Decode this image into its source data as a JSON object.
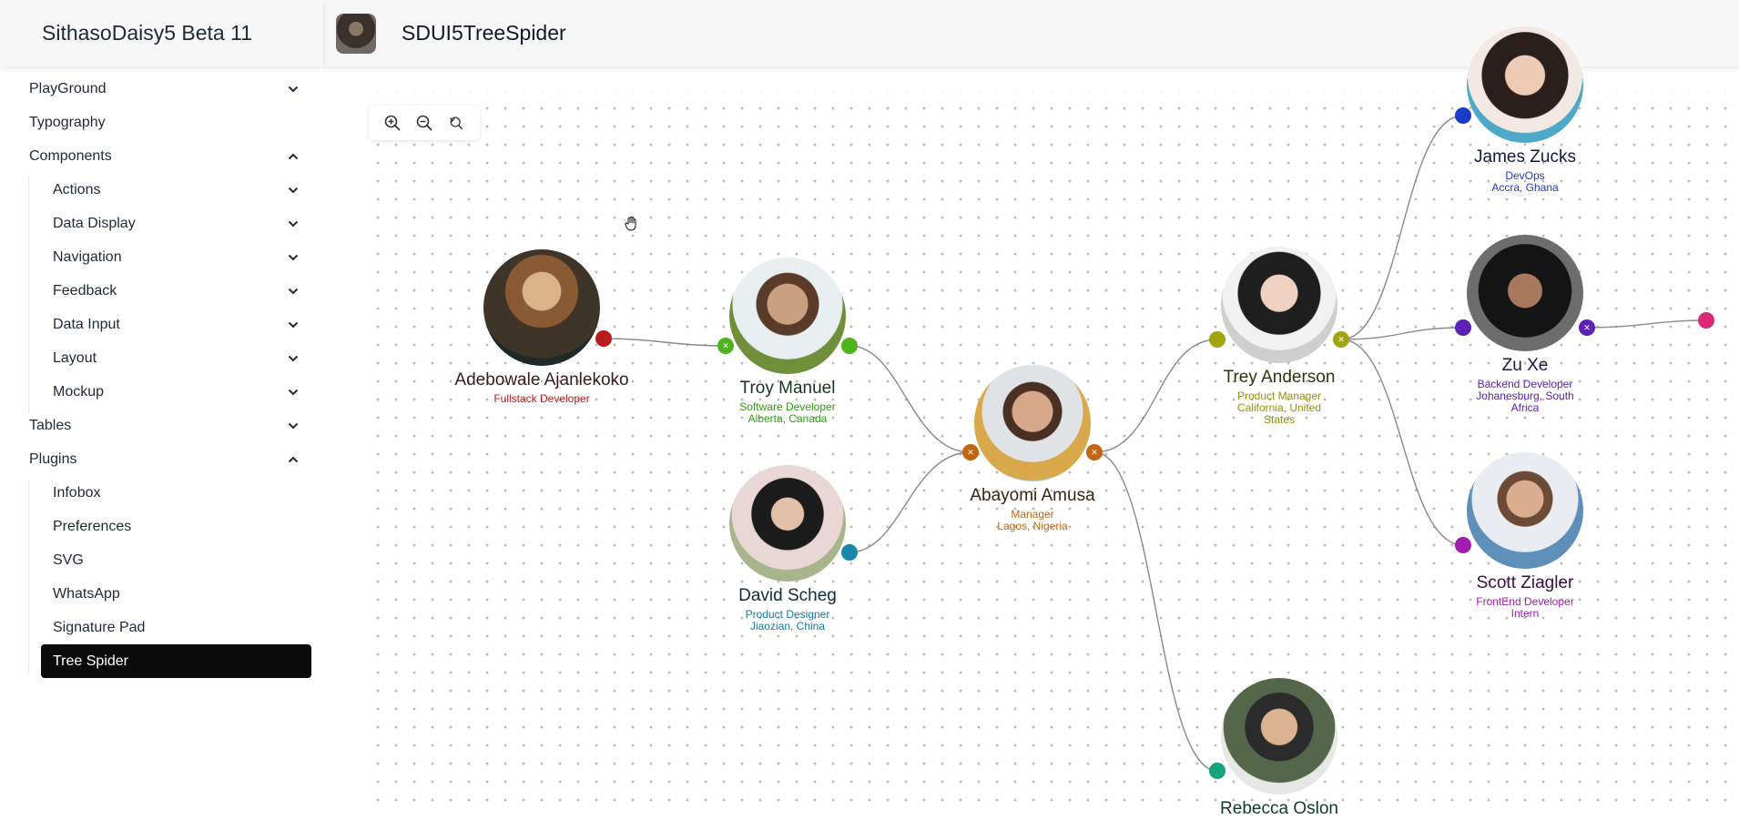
{
  "app": {
    "title": "SithasoDaisy5 Beta 11",
    "page_title": "SDUI5TreeSpider"
  },
  "sidebar": {
    "items": [
      {
        "label": "PlayGround",
        "chevron": "down",
        "level": 0
      },
      {
        "label": "Typography",
        "chevron": "",
        "level": 0
      },
      {
        "label": "Components",
        "chevron": "up",
        "level": 0
      },
      {
        "label": "Actions",
        "chevron": "down",
        "level": 1
      },
      {
        "label": "Data Display",
        "chevron": "down",
        "level": 1
      },
      {
        "label": "Navigation",
        "chevron": "down",
        "level": 1
      },
      {
        "label": "Feedback",
        "chevron": "down",
        "level": 1
      },
      {
        "label": "Data Input",
        "chevron": "down",
        "level": 1
      },
      {
        "label": "Layout",
        "chevron": "down",
        "level": 1
      },
      {
        "label": "Mockup",
        "chevron": "down",
        "level": 1
      },
      {
        "label": "Tables",
        "chevron": "down",
        "level": 0
      },
      {
        "label": "Plugins",
        "chevron": "up",
        "level": 0
      },
      {
        "label": "Infobox",
        "chevron": "",
        "level": 1
      },
      {
        "label": "Preferences",
        "chevron": "",
        "level": 1
      },
      {
        "label": "SVG",
        "chevron": "",
        "level": 1
      },
      {
        "label": "WhatsApp",
        "chevron": "",
        "level": 1
      },
      {
        "label": "Signature Pad",
        "chevron": "",
        "level": 1
      },
      {
        "label": "Tree Spider",
        "chevron": "",
        "level": 1,
        "active": true
      }
    ]
  },
  "toolbar": {
    "zoom_in": "zoom-in-icon",
    "zoom_out": "zoom-out-icon",
    "reset": "zoom-reset-icon"
  },
  "tree": {
    "nodes": {
      "adebowale": {
        "name": "Adebowale Ajanlekoko",
        "role": "Fullstack Developer",
        "location": "",
        "color": "#b91c1c"
      },
      "troy": {
        "name": "Troy Manuel",
        "role": "Software Developer",
        "location": "Alberta, Canada",
        "color": "#4bb31c"
      },
      "david": {
        "name": "David Scheg",
        "role": "Product Designer",
        "location": "Jiaozian, China",
        "color": "#1987a8"
      },
      "abayomi": {
        "name": "Abayomi Amusa",
        "role": "Manager",
        "location": "Lagos, Nigeria",
        "color": "#c2650f"
      },
      "trey": {
        "name": "Trey Anderson",
        "role": "Product Manager",
        "location": "California, United States",
        "color": "#a1a50d"
      },
      "rebecca": {
        "name": "Rebecca Oslon",
        "role": "",
        "location": "",
        "color": "#14a37a"
      },
      "james": {
        "name": "James Zucks",
        "role": "DevOps",
        "location": "Accra, Ghana",
        "color": "#1d3bc9"
      },
      "zuxe": {
        "name": "Zu Xe",
        "role": "Backend Developer",
        "location": "Johanesburg, South Africa",
        "color": "#5b21b6"
      },
      "scott": {
        "name": "Scott Ziagler",
        "role": "FrontEnd Developer Intern",
        "location": "",
        "color": "#a21caf"
      }
    }
  },
  "colors": {
    "link": "#8a8a8a",
    "active_bg": "#0b0b0b",
    "header_bg": "#f7f7f7"
  }
}
